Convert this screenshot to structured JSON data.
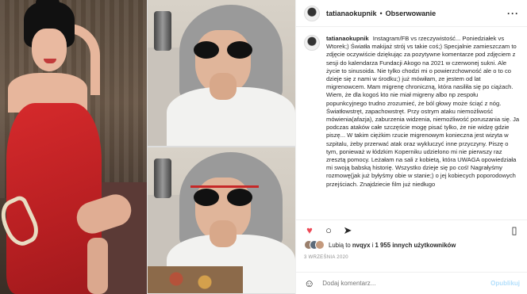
{
  "header": {
    "username": "tatianaokupnik",
    "separator": "•",
    "follow_status": "Obserwowanie",
    "more": "···"
  },
  "caption": {
    "username": "tatianaokupnik",
    "text": "Instagram/FB vs rzeczywistość... Poniedziałek vs Wtorek;) Światła makijaż strój vs takie coś;) Specjalnie zamieszczam to zdjęcie oczywiście dziękując za pozytywne komentarze pod zdjęciem z sesji do kalendarza Fundacji Akogo na 2021 w czerwonej sukni. Ale życie to sinusoida. Nie tylko chodzi mi o powierzchowność ale o to co dzieje się z nami w środku;) już mówiłam, ze jestem od lat migrenowcem. Mam migrenę chroniczną, która nasiliła się po ciążach. Wiem, że dla kogoś kto nie miał migreny albo np zespołu popunkcyjnego trudno zrozumieć, że ból głowy może ściąć z nóg. Światłowstręt, zapachowstręt. Przy ostrym ataku niemożliwość mówienia(afazja), zaburzenia widzenia, niemożliwość poruszania się. Ja podczas ataków całe szczęście mogę pisać tylko, że nie widzę gdzie piszę... W takim ciężkim rzucie migrenowym konieczna jest wizyta w szpitalu, żeby przerwać atak oraz wykluczyć inne przyczyny. Piszę o tym, ponieważ w łódzkim Koperniku udzielono mi nie pierwszy raz zresztą pomocy. Leżałam na sali z kobietą, która UWAGA opowiedziała mi swoją babską historię. Wszystko dzieje się po coś! Nagrałyśmy rozmowę(jak już byłyśmy obie w stanie;) o jej kobiecych poporodowych przejściach. Znajdziecie film już niedługo"
  },
  "actions": {
    "like_icon": "♥",
    "comment_icon": "○",
    "share_icon": "➤",
    "save_icon": "▯"
  },
  "likes": {
    "prefix": "Lubią to",
    "first_user": "nvqyx",
    "and": "i",
    "count": "1 955 innych użytkowników"
  },
  "date": "3 WRZEŚNIA 2020",
  "comment": {
    "emoji": "☺",
    "placeholder": "Dodaj komentarz...",
    "post_label": "Opublikuj"
  },
  "colors": {
    "like": "#ed4956",
    "post_disabled": "#b2dffc",
    "muted": "#8e8e8e"
  }
}
